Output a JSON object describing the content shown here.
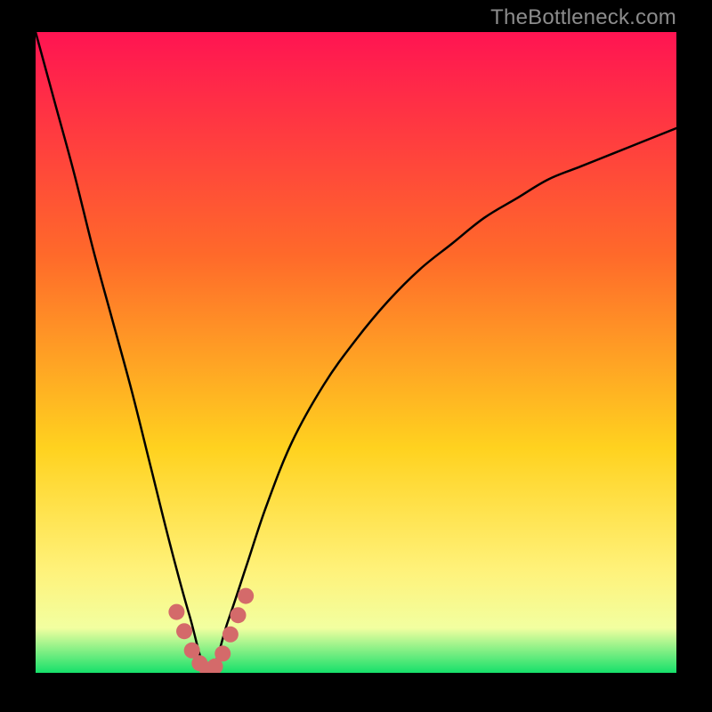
{
  "watermark": "TheBottleneck.com",
  "colors": {
    "background": "#000000",
    "gradient_top": "#ff1452",
    "gradient_mid1": "#ff6a2a",
    "gradient_mid2": "#ffd21f",
    "gradient_mid3": "#fff27a",
    "gradient_low": "#f2ffa0",
    "gradient_bottom": "#16e06a",
    "curve": "#000000",
    "marker": "#d46a6a"
  },
  "watermark_style": {
    "color": "#8c8c8c",
    "font_size_px": 24
  },
  "chart_data": {
    "type": "line",
    "title": "",
    "xlabel": "",
    "ylabel": "",
    "xlim": [
      0,
      1
    ],
    "ylim": [
      0,
      1
    ],
    "note": "Axes are unlabeled; values are normalized fractions of the plot width (x) and height (y). y=1 is the top of the plot, y=0 is the bottom. The curve is a V shape with its minimum near x≈0.27, y≈0. The marker series highlights the bottom of the V.",
    "series": [
      {
        "name": "bottleneck-curve",
        "x": [
          0.0,
          0.03,
          0.06,
          0.09,
          0.12,
          0.15,
          0.18,
          0.21,
          0.24,
          0.27,
          0.3,
          0.33,
          0.36,
          0.4,
          0.45,
          0.5,
          0.55,
          0.6,
          0.65,
          0.7,
          0.75,
          0.8,
          0.85,
          0.9,
          0.95,
          1.0
        ],
        "y": [
          1.0,
          0.89,
          0.78,
          0.66,
          0.55,
          0.44,
          0.32,
          0.2,
          0.09,
          0.0,
          0.08,
          0.17,
          0.26,
          0.36,
          0.45,
          0.52,
          0.58,
          0.63,
          0.67,
          0.71,
          0.74,
          0.77,
          0.79,
          0.81,
          0.83,
          0.85
        ]
      },
      {
        "name": "bottom-markers",
        "x": [
          0.22,
          0.232,
          0.244,
          0.256,
          0.268,
          0.28,
          0.292,
          0.304,
          0.316,
          0.328
        ],
        "y": [
          0.095,
          0.065,
          0.035,
          0.015,
          0.005,
          0.01,
          0.03,
          0.06,
          0.09,
          0.12
        ]
      }
    ]
  }
}
